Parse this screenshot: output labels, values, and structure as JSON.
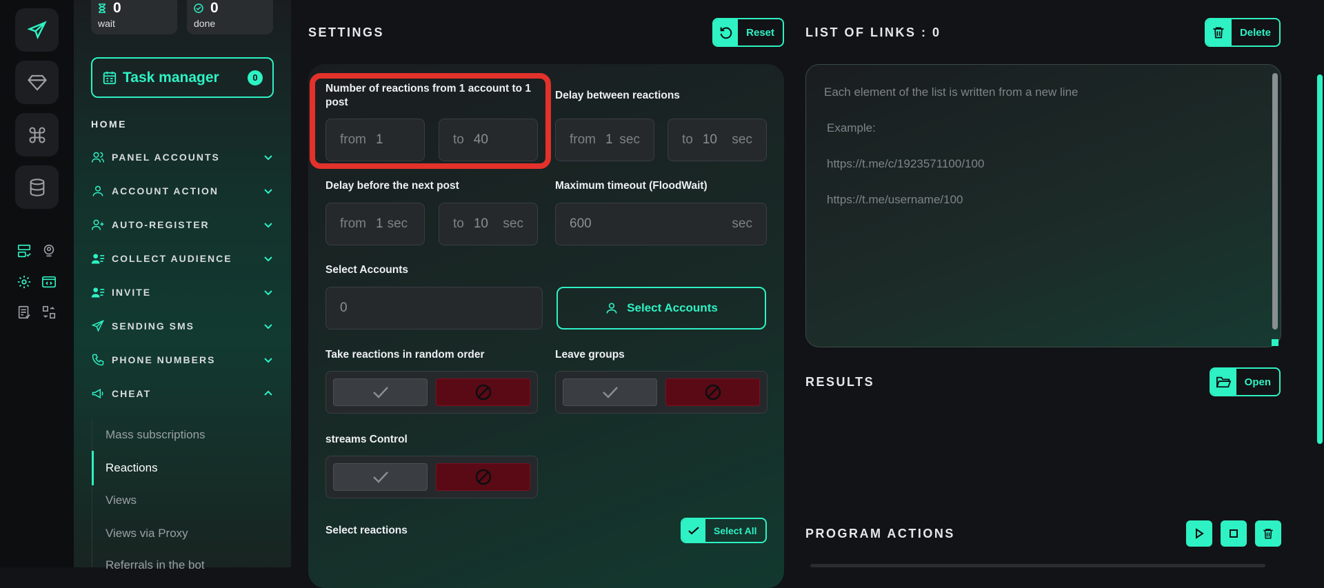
{
  "stats": {
    "wait": {
      "value": "0",
      "label": "wait"
    },
    "done": {
      "value": "0",
      "label": "done"
    }
  },
  "task_manager": {
    "label": "Task manager",
    "count": "0"
  },
  "sidebar": {
    "home": "HOME",
    "items": [
      {
        "label": "PANEL ACCOUNTS",
        "icon": "users-icon"
      },
      {
        "label": "ACCOUNT ACTION",
        "icon": "user-icon"
      },
      {
        "label": "AUTO-REGISTER",
        "icon": "user-plus-icon"
      },
      {
        "label": "COLLECT AUDIENCE",
        "icon": "user-list-icon"
      },
      {
        "label": "INVITE",
        "icon": "user-list-icon"
      },
      {
        "label": "SENDING SMS",
        "icon": "send-icon"
      },
      {
        "label": "PHONE NUMBERS",
        "icon": "phone-icon"
      },
      {
        "label": "CHEAT",
        "icon": "megaphone-icon"
      }
    ],
    "sub_items": [
      "Mass subscriptions",
      "Reactions",
      "Views",
      "Views via Proxy",
      "Referrals in the bot"
    ],
    "active_sub": "Reactions"
  },
  "settings": {
    "title": "SETTINGS",
    "reset_label": "Reset",
    "reactions_per_post": {
      "label": "Number of reactions from 1 account to 1 post",
      "from_prefix": "from",
      "from_value": "1",
      "to_prefix": "to",
      "to_value": "40"
    },
    "delay_between": {
      "label": "Delay between reactions",
      "from_prefix": "from",
      "from_value": "1",
      "to_prefix": "to",
      "to_value": "10",
      "unit": "sec"
    },
    "delay_next_post": {
      "label": "Delay before the next post",
      "from_prefix": "from",
      "from_value": "1",
      "to_prefix": "to",
      "to_value": "10",
      "unit": "sec"
    },
    "max_timeout": {
      "label": "Maximum timeout (FloodWait)",
      "value": "600",
      "unit": "sec"
    },
    "select_accounts": {
      "label": "Select Accounts",
      "value": "0",
      "button": "Select Accounts"
    },
    "random_order": {
      "label": "Take reactions in random order"
    },
    "leave_groups": {
      "label": "Leave groups"
    },
    "streams_control": {
      "label": "streams Control"
    },
    "select_reactions": {
      "label": "Select reactions",
      "select_all": "Select All"
    }
  },
  "links": {
    "title": "LIST OF LINKS : 0",
    "delete_label": "Delete",
    "placeholder_lines": [
      "Each element of the list is written from a new line",
      "Example:",
      "https://t.me/c/1923571100/100",
      "https://t.me/username/100"
    ]
  },
  "results": {
    "title": "RESULTS",
    "open_label": "Open"
  },
  "program_actions": {
    "title": "PROGRAM ACTIONS"
  },
  "colors": {
    "accent": "#2ef2c4",
    "danger": "#5a0a15",
    "highlight": "#e2322b"
  }
}
